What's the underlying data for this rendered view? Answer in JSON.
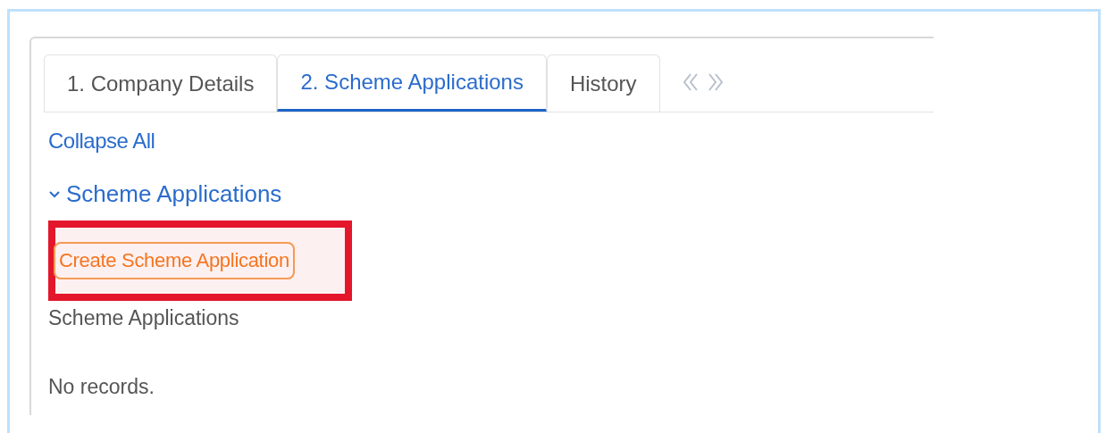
{
  "tabs": [
    {
      "label": "1. Company Details",
      "selected": false
    },
    {
      "label": "2. Scheme Applications",
      "selected": true
    },
    {
      "label": "History",
      "selected": false
    }
  ],
  "collapse_link": "Collapse All",
  "section": {
    "title": "Scheme Applications",
    "expanded": true,
    "create_button": {
      "label": "Create Scheme Application",
      "highlighted": true
    },
    "list_title": "Scheme Applications",
    "empty_message": "No records."
  }
}
